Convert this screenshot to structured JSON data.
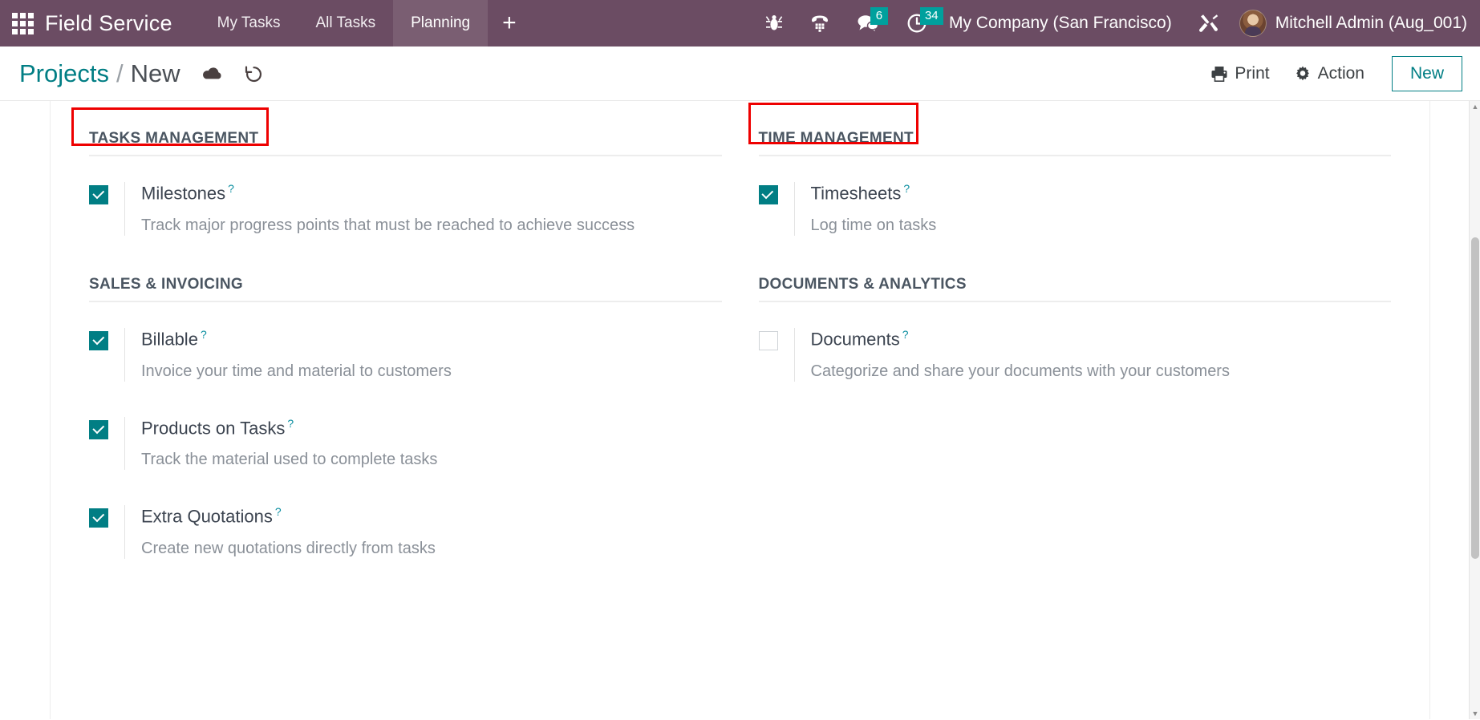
{
  "navbar": {
    "apps_icon": "apps-grid-icon",
    "brand": "Field Service",
    "menus": [
      {
        "label": "My Tasks",
        "active": false
      },
      {
        "label": "All Tasks",
        "active": false
      },
      {
        "label": "Planning",
        "active": true
      }
    ],
    "add_label": "+",
    "systray": [
      {
        "icon": "bug-icon",
        "badge": null
      },
      {
        "icon": "dialpad-phone-icon",
        "badge": null
      },
      {
        "icon": "messages-icon",
        "badge": "6"
      },
      {
        "icon": "activities-clock-icon",
        "badge": "34"
      }
    ],
    "company": "My Company (San Francisco)",
    "debug_icon": "tools-wrench-icon",
    "user": "Mitchell Admin (Aug_001)",
    "badge_color": "#00a09d",
    "bar_color": "#6b4c63"
  },
  "control_panel": {
    "breadcrumb_root": "Projects",
    "breadcrumb_sep": "/",
    "breadcrumb_current": "New",
    "save_icon": "cloud-upload-save-icon",
    "discard_icon": "undo-discard-icon",
    "print_label": "Print",
    "print_icon": "printer-icon",
    "action_label": "Action",
    "action_icon": "gear-icon",
    "new_label": "New",
    "accent_color": "#017e84"
  },
  "settings": {
    "help_marker": "?",
    "sections": [
      {
        "title": "TASKS MANAGEMENT",
        "annotated": true,
        "column": "left",
        "items": [
          {
            "label": "Milestones",
            "description": "Track major progress points that must be reached to achieve success",
            "checked": true
          }
        ]
      },
      {
        "title": "TIME MANAGEMENT",
        "annotated": true,
        "column": "right",
        "items": [
          {
            "label": "Timesheets",
            "description": "Log time on tasks",
            "checked": true
          }
        ]
      },
      {
        "title": "SALES & INVOICING",
        "annotated": false,
        "column": "left",
        "items": [
          {
            "label": "Billable",
            "description": "Invoice your time and material to customers",
            "checked": true
          },
          {
            "label": "Products on Tasks",
            "description": "Track the material used to complete tasks",
            "checked": true
          },
          {
            "label": "Extra Quotations",
            "description": "Create new quotations directly from tasks",
            "checked": true
          }
        ]
      },
      {
        "title": "DOCUMENTS & ANALYTICS",
        "annotated": false,
        "column": "right",
        "items": [
          {
            "label": "Documents",
            "description": "Categorize and share your documents with your customers",
            "checked": false
          }
        ]
      }
    ]
  }
}
